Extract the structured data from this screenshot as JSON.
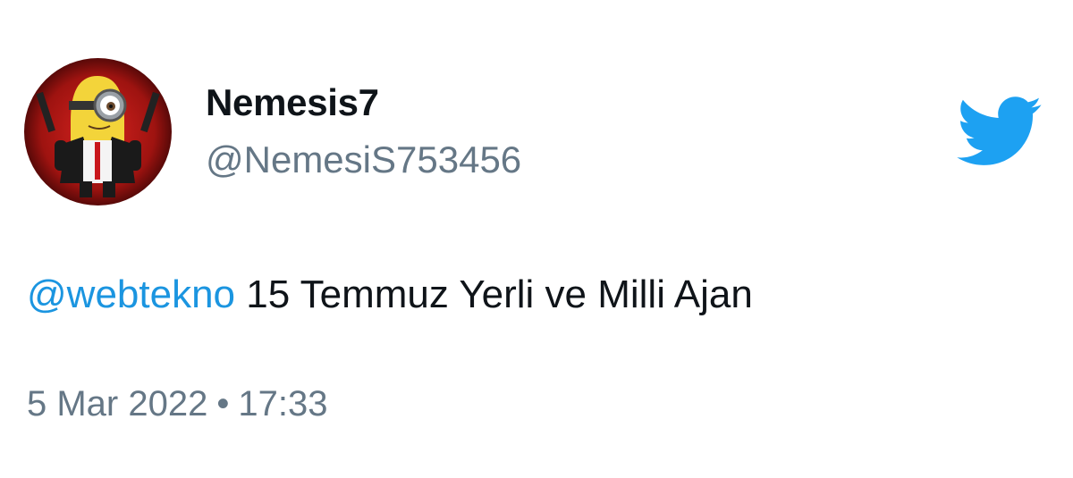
{
  "user": {
    "display_name": "Nemesis7",
    "handle": "@NemesiS753456",
    "avatar_icon": "minion-avatar"
  },
  "tweet": {
    "mention": "@webtekno",
    "text": "15 Temmuz Yerli ve Milli Ajan"
  },
  "meta": {
    "date": "5 Mar 2022",
    "separator": "•",
    "time": "17:33"
  },
  "icons": {
    "brand": "twitter-bird-icon"
  },
  "colors": {
    "brand_blue": "#1da1f2",
    "mention_blue": "#1b95e0",
    "secondary_text": "#657786",
    "primary_text": "#0f1419"
  }
}
